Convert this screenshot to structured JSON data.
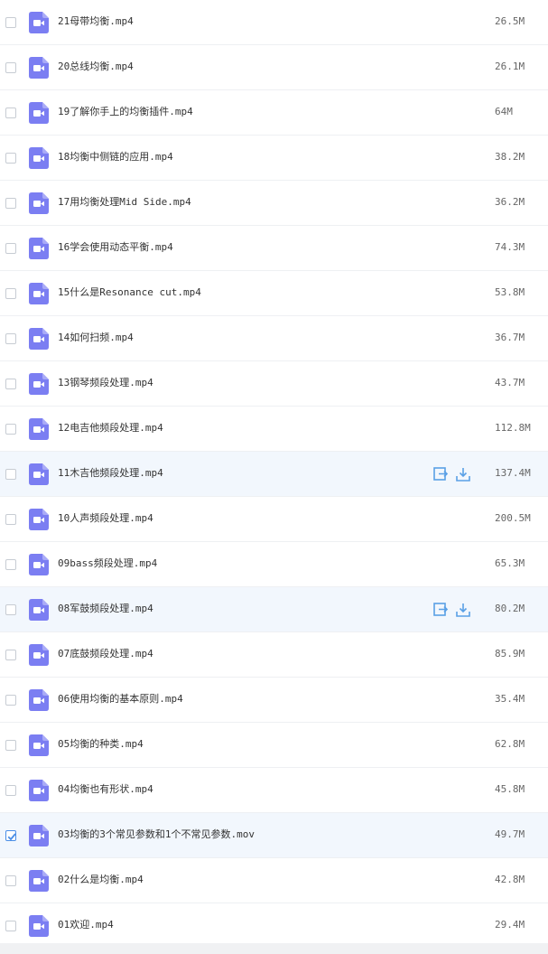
{
  "files": [
    {
      "name": "21母带均衡.mp4",
      "size": "26.5M",
      "checked": false,
      "hover": false
    },
    {
      "name": "20总线均衡.mp4",
      "size": "26.1M",
      "checked": false,
      "hover": false
    },
    {
      "name": "19了解你手上的均衡插件.mp4",
      "size": "64M",
      "checked": false,
      "hover": false
    },
    {
      "name": "18均衡中侧链的应用.mp4",
      "size": "38.2M",
      "checked": false,
      "hover": false
    },
    {
      "name": "17用均衡处理Mid Side.mp4",
      "size": "36.2M",
      "checked": false,
      "hover": false
    },
    {
      "name": "16学会使用动态平衡.mp4",
      "size": "74.3M",
      "checked": false,
      "hover": false
    },
    {
      "name": "15什么是Resonance cut.mp4",
      "size": "53.8M",
      "checked": false,
      "hover": false
    },
    {
      "name": "14如何扫频.mp4",
      "size": "36.7M",
      "checked": false,
      "hover": false
    },
    {
      "name": "13钢琴频段处理.mp4",
      "size": "43.7M",
      "checked": false,
      "hover": false
    },
    {
      "name": "12电吉他频段处理.mp4",
      "size": "112.8M",
      "checked": false,
      "hover": false
    },
    {
      "name": "11木吉他频段处理.mp4",
      "size": "137.4M",
      "checked": false,
      "hover": true
    },
    {
      "name": "10人声频段处理.mp4",
      "size": "200.5M",
      "checked": false,
      "hover": false
    },
    {
      "name": "09bass频段处理.mp4",
      "size": "65.3M",
      "checked": false,
      "hover": false
    },
    {
      "name": "08军鼓频段处理.mp4",
      "size": "80.2M",
      "checked": false,
      "hover": true
    },
    {
      "name": "07底鼓频段处理.mp4",
      "size": "85.9M",
      "checked": false,
      "hover": false
    },
    {
      "name": "06使用均衡的基本原则.mp4",
      "size": "35.4M",
      "checked": false,
      "hover": false
    },
    {
      "name": "05均衡的种类.mp4",
      "size": "62.8M",
      "checked": false,
      "hover": false
    },
    {
      "name": "04均衡也有形状.mp4",
      "size": "45.8M",
      "checked": false,
      "hover": false
    },
    {
      "name": "03均衡的3个常见参数和1个不常见参数.mov",
      "size": "49.7M",
      "checked": true,
      "hover": false
    },
    {
      "name": "02什么是均衡.mp4",
      "size": "42.8M",
      "checked": false,
      "hover": false
    },
    {
      "name": "01欢迎.mp4",
      "size": "29.4M",
      "checked": false,
      "hover": false
    }
  ],
  "icons": {
    "file": "video-file-icon",
    "share": "share-icon",
    "download": "download-icon",
    "check": "check-icon"
  },
  "colors": {
    "file_icon": "#7b7ef2",
    "action_icon": "#5aa0e6",
    "checkbox_checked": "#4a8ee6",
    "row_highlight": "#f2f7fd"
  }
}
